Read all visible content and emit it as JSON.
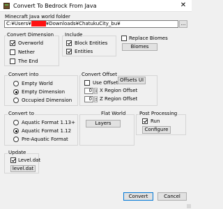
{
  "window": {
    "title": "Convert To Bedrock From Java",
    "close_glyph": "✕"
  },
  "world_folder": {
    "label": "Minecraft Java world folder",
    "path_prefix": "C:¥Users¥",
    "path_suffix": "¥Downloads¥ChatukuCity_bu¥",
    "browse_label": "..."
  },
  "convert_dimension": {
    "title": "Convert Dimension",
    "items": [
      {
        "label": "Overworld",
        "checked": true
      },
      {
        "label": "Nether",
        "checked": false
      },
      {
        "label": "The End",
        "checked": false
      }
    ]
  },
  "include": {
    "title": "Include",
    "items": [
      {
        "label": "Block Entities",
        "checked": true
      },
      {
        "label": "Entities",
        "checked": true
      }
    ]
  },
  "replace_biomes": {
    "label": "Replace Biomes",
    "checked": false,
    "button_label": "Biomes"
  },
  "convert_into": {
    "title": "Convert into",
    "options": [
      {
        "label": "Empty World",
        "selected": false
      },
      {
        "label": "Empty Dimension",
        "selected": true
      },
      {
        "label": "Occupied Dimension",
        "selected": false
      }
    ]
  },
  "convert_offset": {
    "title": "Convert Offset",
    "use_offsets_label": "Use Offsets",
    "use_offsets_checked": false,
    "offsets_ui_label": "Offsets UI",
    "x_value": "0",
    "x_label": "X Region Offset",
    "z_value": "0",
    "z_label": "Z Region Offset"
  },
  "convert_to": {
    "title": "Convert to",
    "options": [
      {
        "label": "Aquatic Format 1.13+",
        "selected": false
      },
      {
        "label": "Aquatic Format 1.12",
        "selected": true
      },
      {
        "label": "Pre-Aquatic Format",
        "selected": false
      }
    ]
  },
  "flat_world": {
    "title": "Flat World",
    "button_label": "Layers"
  },
  "post_processing": {
    "title": "Post Processing",
    "run_label": "Run",
    "run_checked": true,
    "configure_label": "Configure"
  },
  "update": {
    "title": "Update",
    "leveldat_label": "Level.dat",
    "leveldat_checked": true,
    "button_label": "level.dat"
  },
  "footer": {
    "convert_label": "Convert",
    "cancel_label": "Cancel"
  },
  "colors": {
    "accent": "#0078d7",
    "redaction": "#ff1111"
  }
}
